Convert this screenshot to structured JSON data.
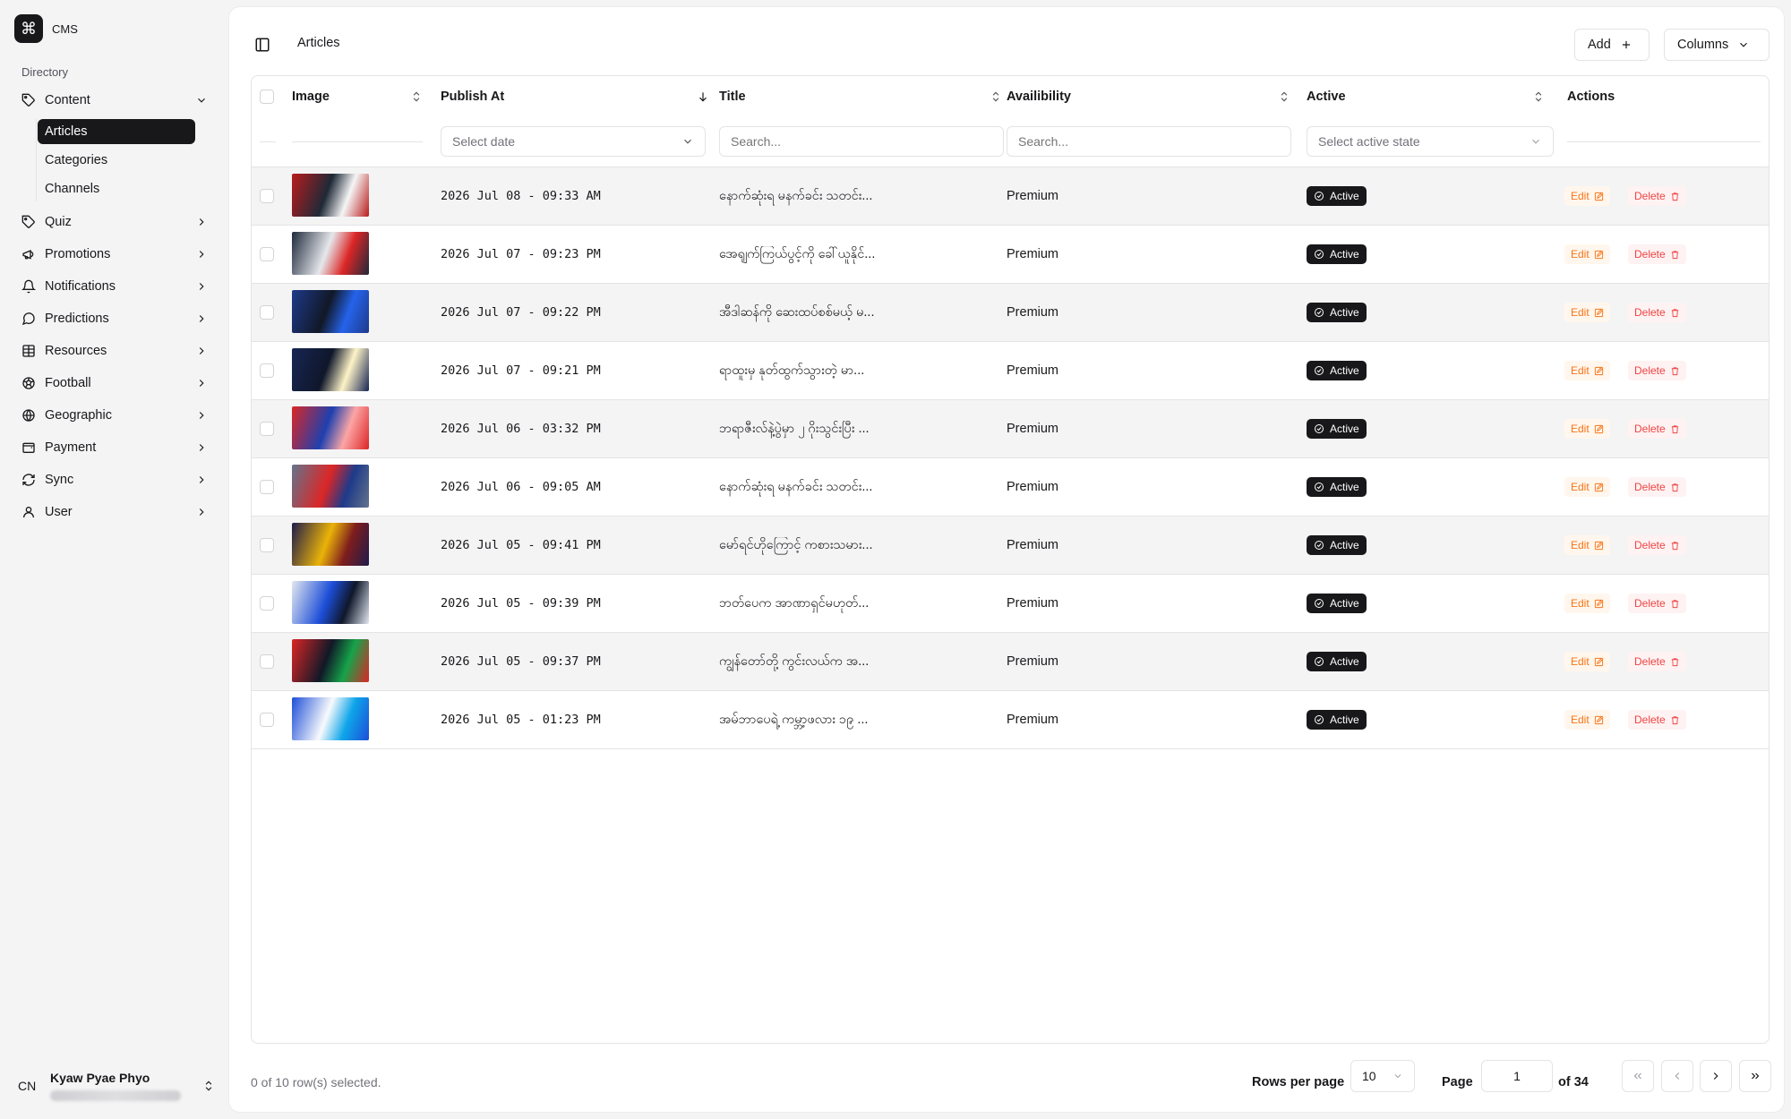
{
  "app": {
    "name": "CMS",
    "logo_glyph": "⌘"
  },
  "sidebar": {
    "group_label": "Directory",
    "content_label": "Content",
    "sub_items": [
      "Articles",
      "Categories",
      "Channels"
    ],
    "items": [
      {
        "label": "Quiz",
        "icon": "tag-icon"
      },
      {
        "label": "Promotions",
        "icon": "megaphone-icon"
      },
      {
        "label": "Notifications",
        "icon": "bell-icon"
      },
      {
        "label": "Predictions",
        "icon": "message-circle-icon"
      },
      {
        "label": "Resources",
        "icon": "grid-icon"
      },
      {
        "label": "Football",
        "icon": "football-icon"
      },
      {
        "label": "Geographic",
        "icon": "globe-icon"
      },
      {
        "label": "Payment",
        "icon": "wallet-icon"
      },
      {
        "label": "Sync",
        "icon": "refresh-icon"
      },
      {
        "label": "User",
        "icon": "user-icon"
      }
    ]
  },
  "user": {
    "initials": "CN",
    "name": "Kyaw Pyae Phyo"
  },
  "header": {
    "title": "Articles",
    "add_label": "Add",
    "columns_label": "Columns"
  },
  "table": {
    "columns": {
      "image": "Image",
      "publish_at": "Publish At",
      "title": "Title",
      "availability": "Availibility",
      "active": "Active",
      "actions": "Actions"
    },
    "filters": {
      "date_placeholder": "Select date",
      "title_placeholder": "Search...",
      "availability_placeholder": "Search...",
      "active_placeholder": "Select active state"
    },
    "edit_label": "Edit",
    "delete_label": "Delete",
    "rows": [
      {
        "date": "2026 Jul 08 - 09:33 AM",
        "title": "နောက်ဆုံးရ မနက်ခင်း သတင်း...",
        "availability": "Premium",
        "status": "Active",
        "thumb": [
          "#b91c1c",
          "#1f2937",
          "#f5f5f5"
        ]
      },
      {
        "date": "2026 Jul 07 - 09:23 PM",
        "title": "အေရျက်ကြယ်ပွင့်ကို ခေါ်ယူနိုင်...",
        "availability": "Premium",
        "status": "Active",
        "thumb": [
          "#1e293b",
          "#e5e7eb",
          "#dc2626"
        ]
      },
      {
        "date": "2026 Jul 07 - 09:22 PM",
        "title": "အီဒါဆန်ကို ဆေးထပ်စစ်မယ့် မ...",
        "availability": "Premium",
        "status": "Active",
        "thumb": [
          "#1e3a8a",
          "#111827",
          "#2563eb"
        ]
      },
      {
        "date": "2026 Jul 07 - 09:21 PM",
        "title": "ရာထူးမှ နုတ်ထွက်သွားတဲ့ မာ...",
        "availability": "Premium",
        "status": "Active",
        "thumb": [
          "#172554",
          "#0f172a",
          "#fef3c7"
        ]
      },
      {
        "date": "2026 Jul 06 - 03:32 PM",
        "title": "ဘရာဇီးလ်နဲ့ပွဲမှာ ၂ ဂိုးသွင်းပြီး ...",
        "availability": "Premium",
        "status": "Active",
        "thumb": [
          "#dc2626",
          "#1e40af",
          "#fca5a5"
        ]
      },
      {
        "date": "2026 Jul 06 - 09:05 AM",
        "title": "နောက်ဆုံးရ မနက်ခင်း သတင်း...",
        "availability": "Premium",
        "status": "Active",
        "thumb": [
          "#64748b",
          "#dc2626",
          "#1e3a8a"
        ]
      },
      {
        "date": "2026 Jul 05 - 09:41 PM",
        "title": "မော်ရင်ဟိုကြောင့် ကစားသမား...",
        "availability": "Premium",
        "status": "Active",
        "thumb": [
          "#1e1b4b",
          "#eab308",
          "#7f1d1d"
        ]
      },
      {
        "date": "2026 Jul 05 - 09:39 PM",
        "title": "ဘတ်ပေက အာဏာရှင်မဟုတ်...",
        "availability": "Premium",
        "status": "Active",
        "thumb": [
          "#e2e8f0",
          "#1d4ed8",
          "#0f172a"
        ]
      },
      {
        "date": "2026 Jul 05 - 09:37 PM",
        "title": "ကျွန်တော်တို့ ကွင်းလယ်က အ...",
        "availability": "Premium",
        "status": "Active",
        "thumb": [
          "#dc2626",
          "#111827",
          "#16a34a"
        ]
      },
      {
        "date": "2026 Jul 05 - 01:23 PM",
        "title": "အမ်ဘာပေရဲ့ ကမ္ဘာ့ဖလား ၁၉ ...",
        "availability": "Premium",
        "status": "Active",
        "thumb": [
          "#1d4ed8",
          "#f8fafc",
          "#0ea5e9"
        ]
      }
    ]
  },
  "pagination": {
    "selected_text": "0 of 10 row(s) selected.",
    "rows_per_page_label": "Rows per page",
    "rows_per_page": "10",
    "page_label": "Page",
    "page": "1",
    "of_text": "of 34"
  },
  "colors": {
    "primary": "#18181b",
    "edit": "#f97316",
    "delete": "#ef4444",
    "stripe": "#f4f4f5"
  }
}
